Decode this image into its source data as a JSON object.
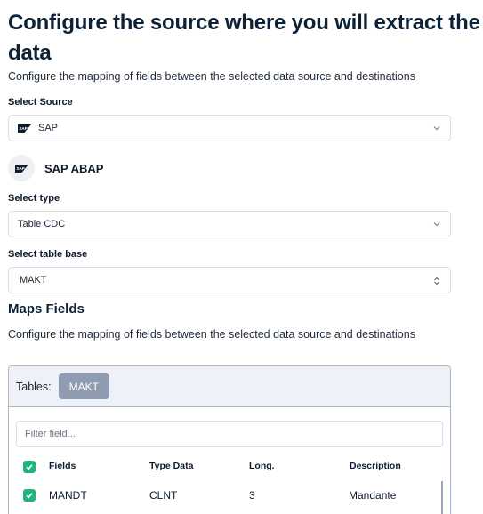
{
  "header": {
    "title": "Configure the source where you will extract the data",
    "subtitle": "Configure the mapping of fields between the selected data source and destinations"
  },
  "source": {
    "label": "Select Source",
    "value": "SAP"
  },
  "connector": {
    "title": "SAP ABAP"
  },
  "type": {
    "label": "Select type",
    "value": "Table CDC"
  },
  "table_base": {
    "label": "Select table base",
    "value": "MAKT"
  },
  "maps": {
    "title": "Maps Fields",
    "description": "Configure the mapping of fields between the selected data source and destinations",
    "tables_label": "Tables:",
    "tables": [
      "MAKT"
    ],
    "filter_placeholder": "Filter field...",
    "columns": [
      "Fields",
      "Type Data",
      "Long.",
      "Description"
    ],
    "rows": [
      {
        "field": "MANDT",
        "type": "CLNT",
        "long": "3",
        "description": "Mandante",
        "checked": true
      }
    ]
  },
  "colors": {
    "check": "#21b57c",
    "chip": "#8e9bb0",
    "title": "#0d2236"
  }
}
